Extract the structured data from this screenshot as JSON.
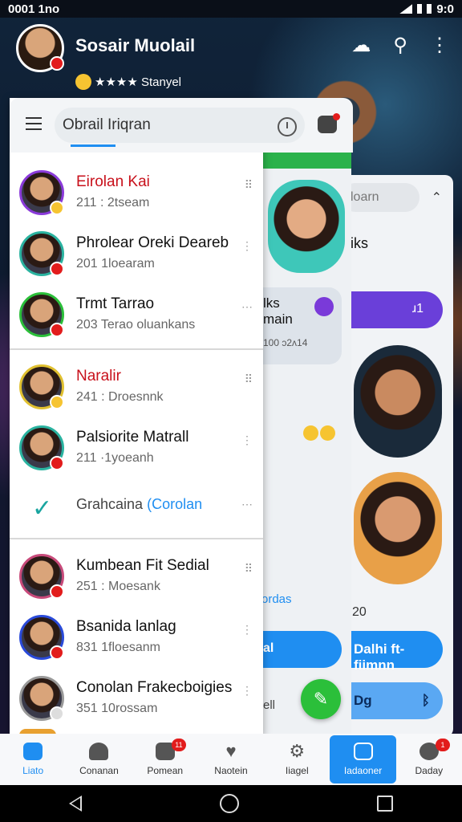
{
  "status_bar": {
    "left": "0001 1no",
    "time": "9:0"
  },
  "profile": {
    "name": "Sosair Muolail",
    "status": "★★★★ Stanyel"
  },
  "header_icons": [
    "cloud-icon",
    "search-icon",
    "more-vert-icon"
  ],
  "search": {
    "value": "Obrail Iriqran"
  },
  "contacts": [
    {
      "name": "Eirolan Kai",
      "sub": "211 : 2tseam",
      "color": "#c8101b",
      "ring": "#8a3ad9"
    },
    {
      "name": "Phrolear Oreki Deareb",
      "sub": "201 1loearam",
      "color": "#111",
      "ring": "#2ab3a0"
    },
    {
      "name": "Trmt Tarrao",
      "sub": "203 Terao oluankans",
      "color": "#111",
      "ring": "#2bbf3a"
    }
  ],
  "contacts2": [
    {
      "name": "Naralir",
      "sub": "241 : Droesnnk",
      "color": "#c8101b",
      "ring": "#e0c030"
    },
    {
      "name": "Palsiorite Matrall",
      "sub": "211 ·1yoeanh",
      "color": "#111",
      "ring": "#2ab3a0"
    }
  ],
  "action_row": {
    "label": "Grahcaina",
    "link": "(Corolan"
  },
  "contacts3": [
    {
      "name": "Kumbean Fit Sedial",
      "sub": "251 : Moesank",
      "color": "#111",
      "ring": "#c84a7a"
    },
    {
      "name": "Bsanida lanlag",
      "sub": "831 1floesanm",
      "color": "#111",
      "ring": "#2a4ad9"
    },
    {
      "name": "Conolan Frakecboigies",
      "sub": "351 10rossam",
      "color": "#111",
      "ring": "#999"
    }
  ],
  "back_card": {
    "search_placeholder": "loarn",
    "label": "iks",
    "pill": "ɹ1",
    "num": "20",
    "bubble1": "Dalhi ft-fiimnn",
    "bubble2": "Dg"
  },
  "mid_card": {
    "bubble_title": "lks",
    "bubble_sub": "main",
    "bubble_meta": "100 ɔ2ʌ14",
    "text": "ordas",
    "blue": "al",
    "gray": "ell"
  },
  "bottom_nav": [
    {
      "label": "Liato",
      "icon": "home-icon"
    },
    {
      "label": "Conanan",
      "icon": "bell-icon"
    },
    {
      "label": "Pomean",
      "icon": "chat-icon",
      "badge": "11"
    },
    {
      "label": "Naotein",
      "icon": "heart-icon"
    },
    {
      "label": "Iiagel",
      "icon": "gear-icon"
    },
    {
      "label": "Iadaoner",
      "icon": "compose-icon"
    },
    {
      "label": "Daday",
      "icon": "person-icon",
      "badge": "1"
    }
  ],
  "colors": {
    "accent": "#1f8ef1",
    "alert": "#e21c1c",
    "fab": "#2bbf3a"
  }
}
